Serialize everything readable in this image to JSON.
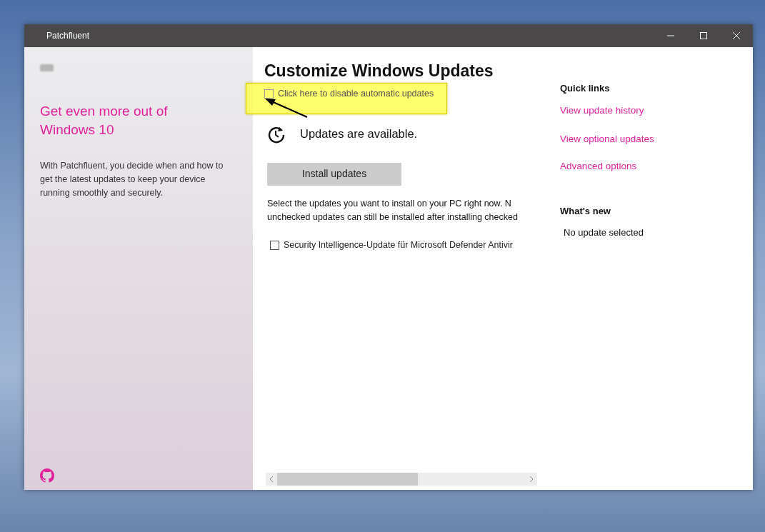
{
  "window": {
    "title": "Patchfluent"
  },
  "sidebar": {
    "heading": "Get even more out of Windows 10",
    "description": "With Patchfluent, you decide when and how to get the latest updates to keep your device running smoothly and securely."
  },
  "main": {
    "title": "Customize Windows Updates",
    "auto_update_toggle": {
      "label": "Click here to disable automatic updates",
      "checked": false
    },
    "status": "Updates are available.",
    "install_button": "Install updates",
    "instructions": [
      "Select the updates you want to install on your PC right now. N",
      "unchecked updates can still be installed after installing checked"
    ],
    "updates": [
      {
        "label": "Security Intelligence-Update für Microsoft Defender Antivir",
        "checked": false
      }
    ]
  },
  "quick_links": {
    "heading": "Quick links",
    "links": [
      "View update history",
      "View optional updates",
      "Advanced options"
    ]
  },
  "whats_new": {
    "heading": "What's new",
    "text": "No update selected"
  }
}
